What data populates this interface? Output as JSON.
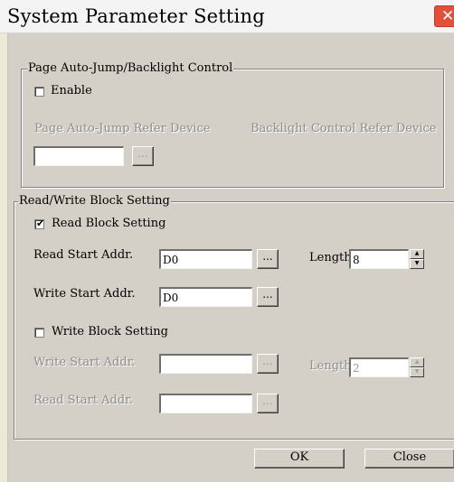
{
  "window": {
    "title": "System Parameter Setting",
    "close_glyph": "✕"
  },
  "page_group": {
    "legend": "Page Auto-Jump/Backlight Control",
    "enable_label": "Enable",
    "enable_checked": false,
    "page_refer_label": "Page Auto-Jump Refer Device",
    "backlight_refer_label": "Backlight Control Refer Device",
    "device_value": "",
    "browse_label": "..."
  },
  "rw_group": {
    "legend": "Read/Write Block Setting",
    "read_block_label": "Read Block Setting",
    "read_block_checked": true,
    "read_start_label": "Read Start Addr.",
    "read_start_value": "D0",
    "length_label": "Length",
    "read_length_value": "8",
    "write_start_label": "Write Start Addr.",
    "write_start_value": "D0",
    "write_block_label": "Write Block Setting",
    "write_block_checked": false,
    "write_start2_label": "Write Start Addr.",
    "write_start2_value": "",
    "write_length_value": "2",
    "read_start2_label": "Read Start Addr.",
    "read_start2_value": "",
    "browse_label": "..."
  },
  "footer": {
    "ok_label": "OK",
    "close_label": "Close"
  }
}
